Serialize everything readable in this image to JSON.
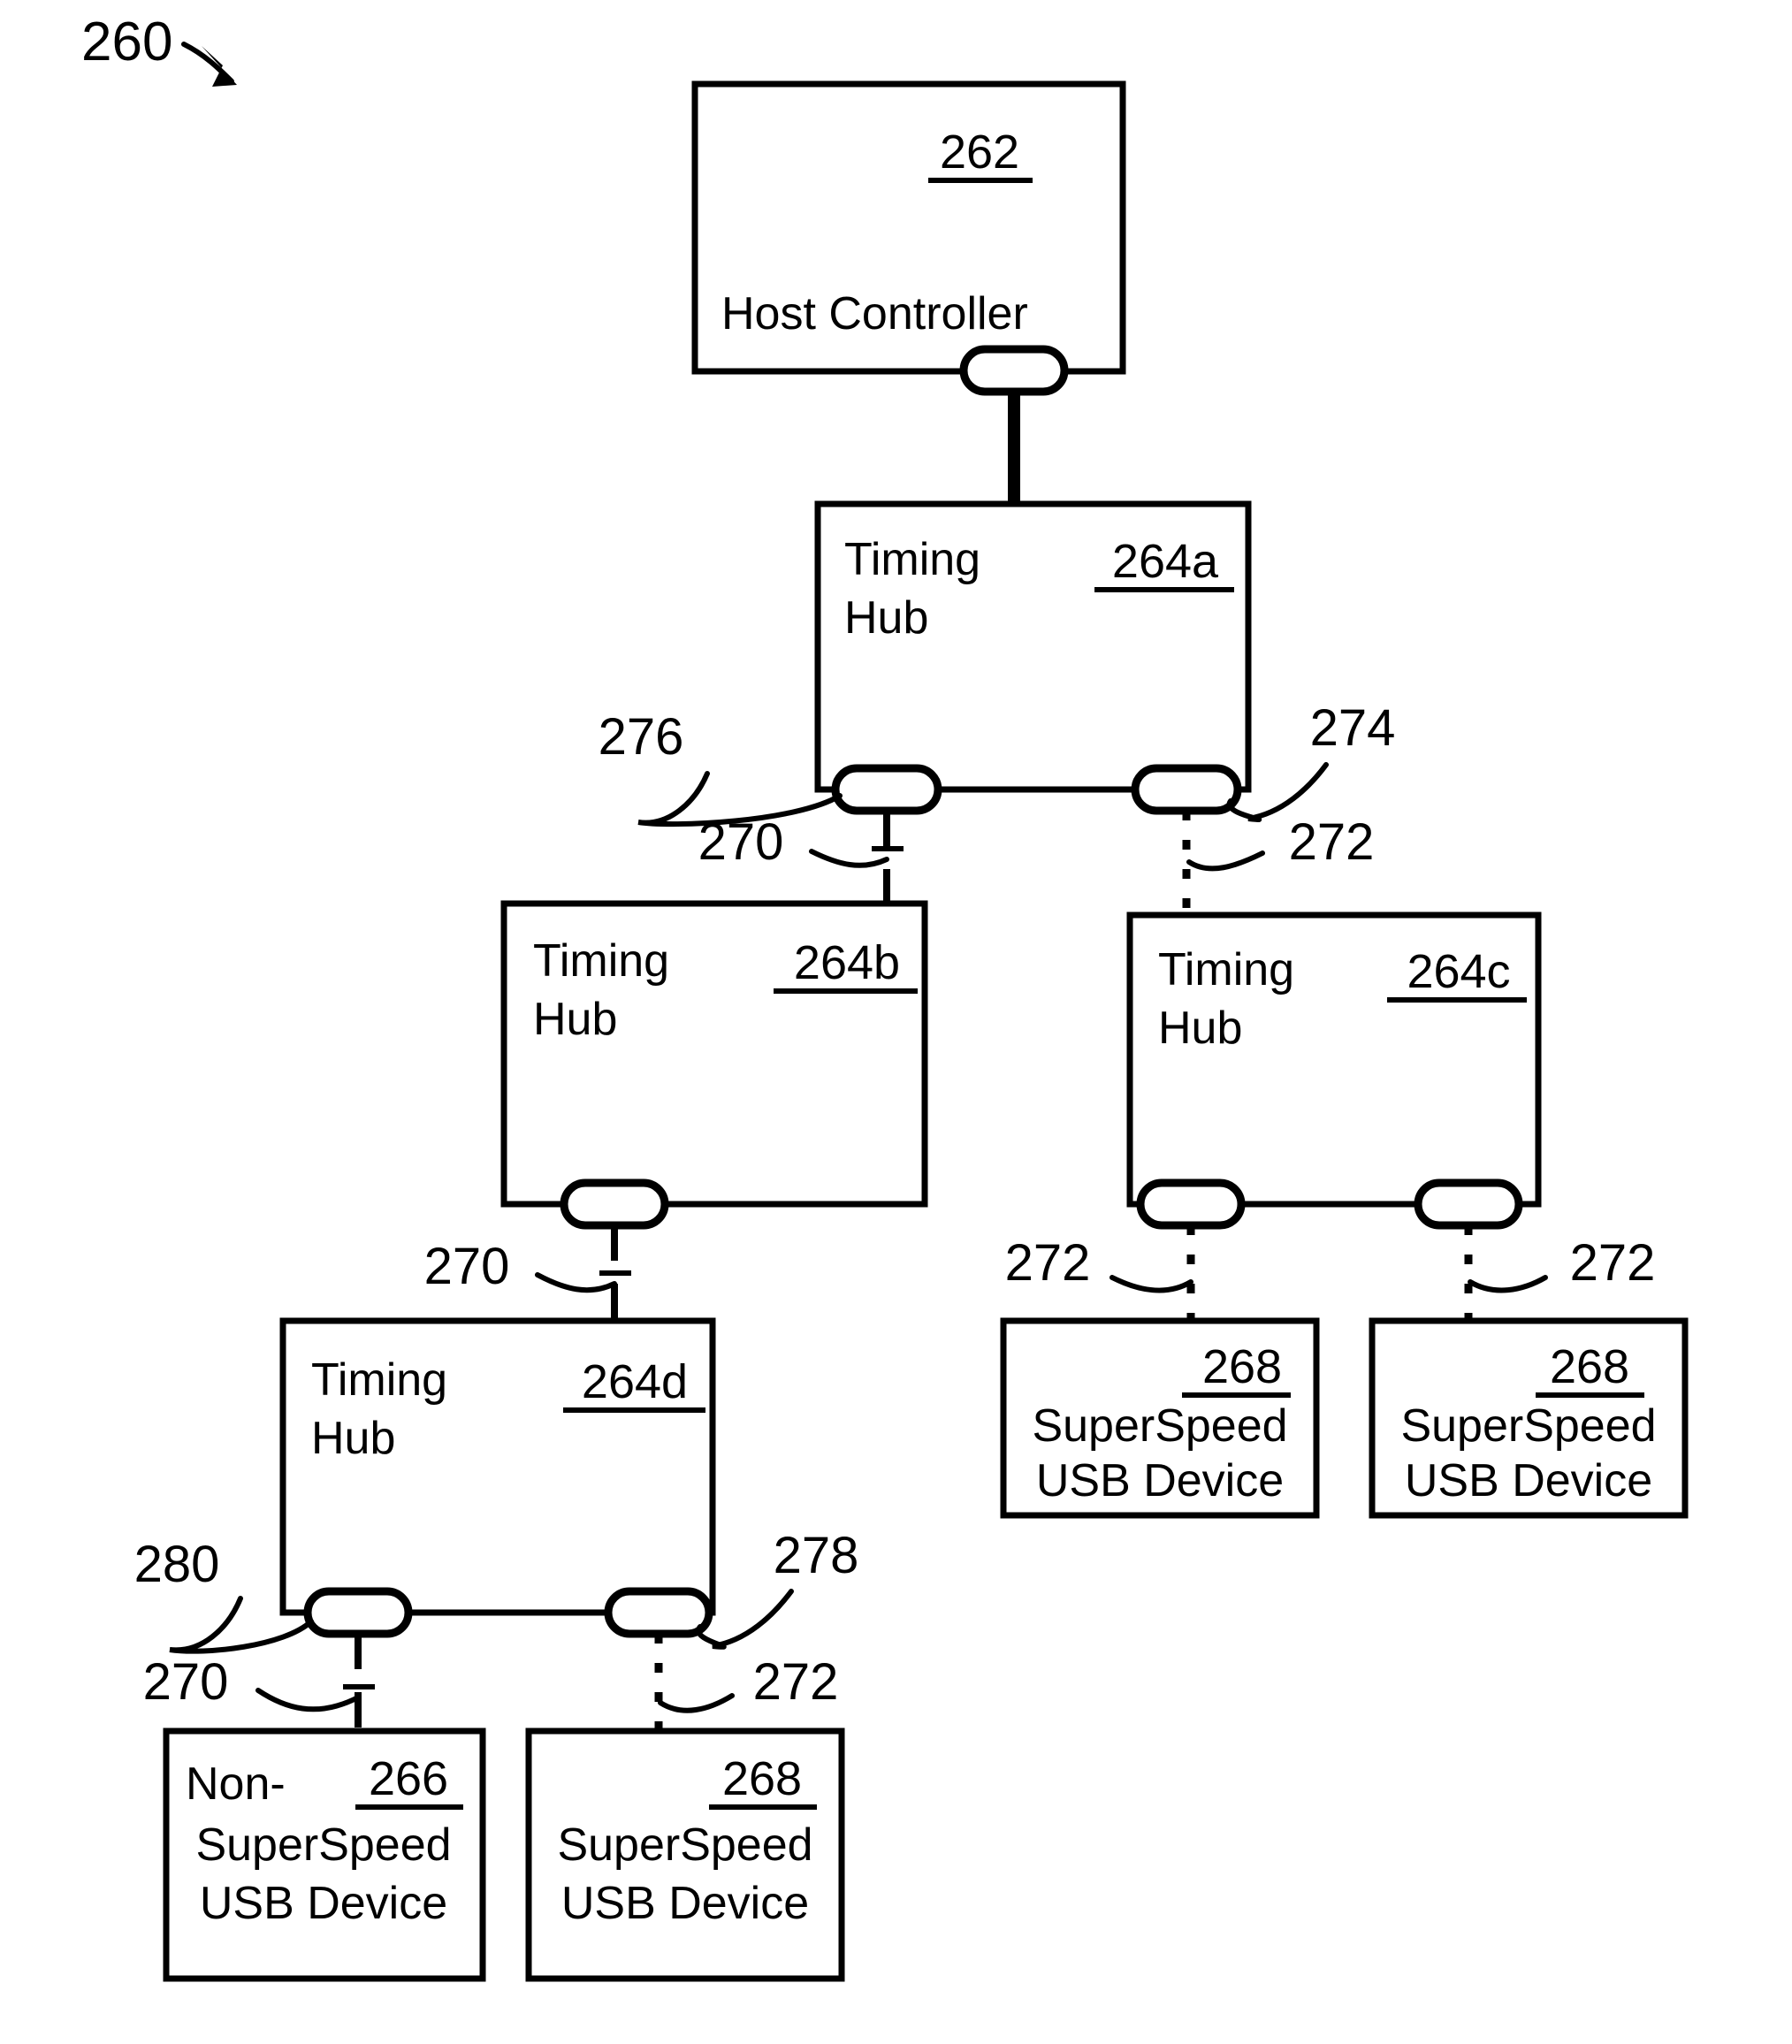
{
  "figure": {
    "number": "260",
    "kind": "usb-topology-block-diagram"
  },
  "nodes": {
    "host_controller": {
      "ref": "262",
      "title": "Host Controller"
    },
    "hub_a": {
      "ref": "264a",
      "title_line1": "Timing",
      "title_line2": "Hub"
    },
    "hub_b": {
      "ref": "264b",
      "title_line1": "Timing",
      "title_line2": "Hub"
    },
    "hub_c": {
      "ref": "264c",
      "title_line1": "Timing",
      "title_line2": "Hub"
    },
    "hub_d": {
      "ref": "264d",
      "title_line1": "Timing",
      "title_line2": "Hub"
    },
    "device_c_left": {
      "ref": "268",
      "title_line1": "SuperSpeed",
      "title_line2": "USB Device"
    },
    "device_c_right": {
      "ref": "268",
      "title_line1": "SuperSpeed",
      "title_line2": "USB Device"
    },
    "device_non_ss": {
      "ref": "266",
      "title_line1": "Non-",
      "title_line2": "SuperSpeed",
      "title_line3": "USB Device"
    },
    "device_d_ss": {
      "ref": "268",
      "title_line1": "SuperSpeed",
      "title_line2": "USB Device"
    }
  },
  "callouts": {
    "hub_a_port_left": "276",
    "hub_a_port_right": "274",
    "hub_a_link_left": "270",
    "hub_a_link_right": "272",
    "hub_b_link_down": "270",
    "hub_c_link_left": "272",
    "hub_c_link_right": "272",
    "hub_d_port_left": "280",
    "hub_d_port_right": "278",
    "hub_d_link_left": "270",
    "hub_d_link_right": "272"
  },
  "colors": {
    "ink": "#000000",
    "paper": "#ffffff"
  }
}
